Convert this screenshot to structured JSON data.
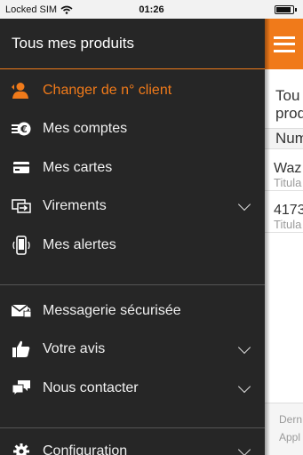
{
  "status_bar": {
    "carrier": "Locked SIM",
    "time": "01:26",
    "battery_level": 0.9
  },
  "drawer": {
    "title": "Tous mes produits",
    "accent_color": "#f07a1a",
    "items_group1": [
      {
        "label": "Changer de n° client",
        "icon": "user-switch-icon",
        "active": true,
        "chevron": false
      },
      {
        "label": "Mes comptes",
        "icon": "euro-coins-icon",
        "active": false,
        "chevron": false
      },
      {
        "label": "Mes cartes",
        "icon": "credit-card-icon",
        "active": false,
        "chevron": false
      },
      {
        "label": "Virements",
        "icon": "transfer-icon",
        "active": false,
        "chevron": true
      },
      {
        "label": "Mes alertes",
        "icon": "phone-alert-icon",
        "active": false,
        "chevron": false
      }
    ],
    "items_group2": [
      {
        "label": "Messagerie sécurisée",
        "icon": "secure-mail-icon",
        "active": false,
        "chevron": false
      },
      {
        "label": "Votre avis",
        "icon": "thumbs-up-icon",
        "active": false,
        "chevron": true
      },
      {
        "label": "Nous contacter",
        "icon": "chat-bubbles-icon",
        "active": false,
        "chevron": true
      }
    ],
    "items_group3": [
      {
        "label": "Configuration",
        "icon": "gear-icon",
        "active": false,
        "chevron": true
      }
    ]
  },
  "content": {
    "title": "Tous mes produits",
    "title_line1": "Tou",
    "title_line2": "prod",
    "column_header": "Num",
    "rows": [
      {
        "primary": "Waz",
        "secondary": "Titula"
      },
      {
        "primary": "4173",
        "secondary": "Titula"
      }
    ],
    "footer_line1": "Dern",
    "footer_line2": "Appl"
  }
}
